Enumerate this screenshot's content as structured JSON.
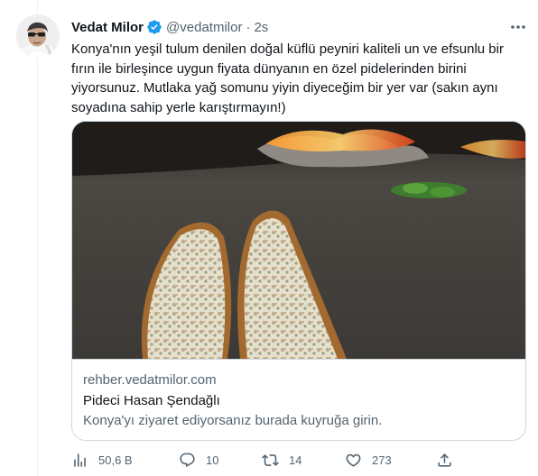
{
  "tweet": {
    "author_name": "Vedat Milor",
    "handle": "@vedatmilor",
    "separator": "·",
    "time": "2s",
    "text": "Konya'nın yeşil tulum denilen doğal küflü peyniri kaliteli un ve efsunlu bir\nfırın ile birleşince uygun fiyata dünyanın en özel pidelerinden birini\nyiyorsunuz. Mutlaka yağ somunu yiyin diyeceğim bir yer var (sakın aynı\nsoyadına sahip yerle karıştırmayın!)"
  },
  "card": {
    "domain": "rehber.vedatmilor.com",
    "title": "Pideci Hasan Şendağlı",
    "description": "Konya'yı ziyaret ediyorsanız burada kuyruğa girin."
  },
  "actions": {
    "views": "50,6 B",
    "replies": "10",
    "retweets": "14",
    "likes": "273"
  },
  "colors": {
    "verified": "#1d9bf0",
    "text_primary": "#0f1419",
    "text_secondary": "#536471",
    "border": "#cfd9de"
  },
  "icons": [
    "verified-badge-icon",
    "more-icon",
    "views-icon",
    "reply-icon",
    "retweet-icon",
    "like-icon",
    "share-icon"
  ]
}
